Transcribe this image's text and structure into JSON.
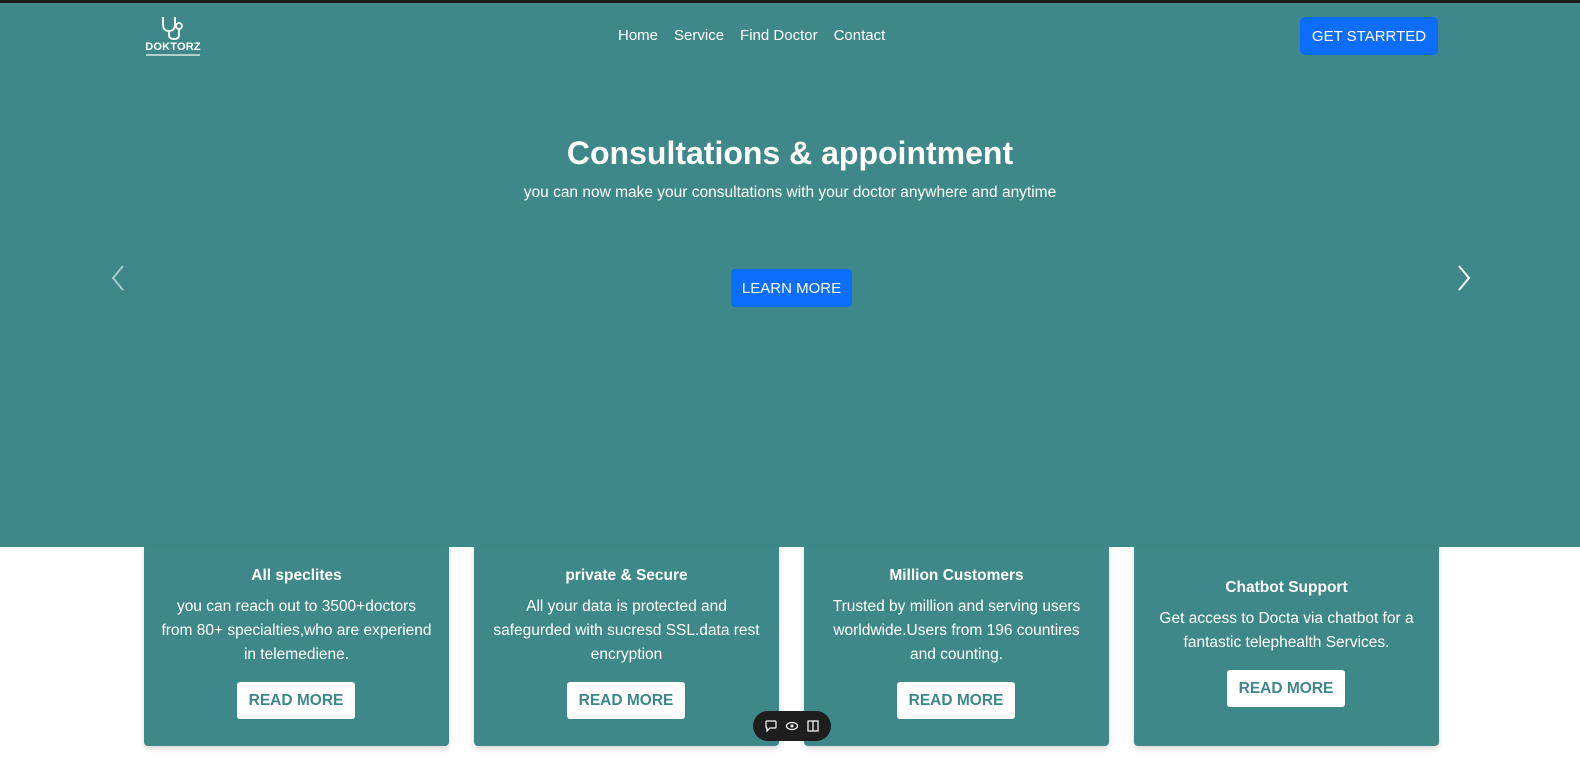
{
  "brand": {
    "name": "DOKTORZ",
    "logo_icon": "stethoscope-icon"
  },
  "nav": {
    "items": [
      {
        "label": "Home"
      },
      {
        "label": "Service"
      },
      {
        "label": "Find Doctor"
      },
      {
        "label": "Contact"
      }
    ],
    "cta_label": "GET STARRTED"
  },
  "hero": {
    "title": "Consultations & appointment",
    "subtitle": "you can now make your consultations with your doctor anywhere and anytime",
    "button_label": "LEARN MORE",
    "prev_icon": "chevron-left-icon",
    "next_icon": "chevron-right-icon"
  },
  "features": [
    {
      "title": "All speclites",
      "text": "you can reach out to 3500+doctors from 80+ specialties,who are experiend in telemediene.",
      "button_label": "READ MORE"
    },
    {
      "title": "private & Secure",
      "text": "All your data is protected and safegurded with sucresd SSL.data rest encryption",
      "button_label": "READ MORE"
    },
    {
      "title": "Million Customers",
      "text": "Trusted by million and serving users worldwide.Users from 196 countires and counting.",
      "button_label": "READ MORE"
    },
    {
      "title": "Chatbot Support",
      "text": "Get access to Docta via chatbot for a fantastic telephealth Services.",
      "button_label": "READ MORE"
    }
  ],
  "floating_toolbar": {
    "icons": [
      "comment-icon",
      "eye-icon",
      "book-icon"
    ]
  },
  "colors": {
    "primary_teal": "#3e8889",
    "button_blue": "#0d6efd",
    "text_white": "#ffffff"
  }
}
